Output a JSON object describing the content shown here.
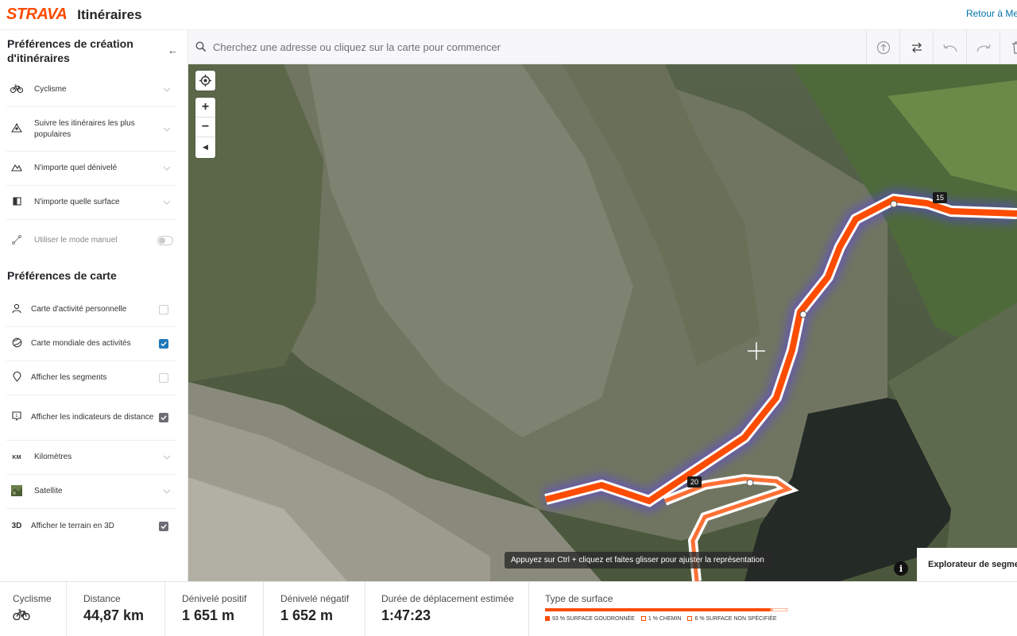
{
  "header": {
    "logo": "STRAVA",
    "title": "Itinéraires",
    "back_link": "Retour à Mes"
  },
  "sidebar": {
    "route_prefs_title": "Préférences de création d'itinéraires",
    "collapse_icon": "arrow-left-icon",
    "route_items": [
      {
        "label": "Cyclisme",
        "icon": "bike-icon"
      },
      {
        "label": "Suivre les itinéraires les plus populaires",
        "icon": "popularity-icon"
      },
      {
        "label": "N'importe quel dénivelé",
        "icon": "elevation-icon"
      },
      {
        "label": "N'importe quelle surface",
        "icon": "surface-icon"
      },
      {
        "label": "Utiliser le mode manuel",
        "icon": "manual-mode-icon",
        "toggle": false
      }
    ],
    "map_prefs_title": "Préférences de carte",
    "map_items": [
      {
        "label": "Carte d'activité personnelle",
        "icon": "person-icon",
        "checked": false
      },
      {
        "label": "Carte mondiale des activités",
        "icon": "globe-icon",
        "checked": true
      },
      {
        "label": "Afficher les segments",
        "icon": "segment-pin-icon",
        "checked": false
      },
      {
        "label": "Afficher les indicateurs de distance",
        "icon": "distance-marker-icon",
        "checked": true
      },
      {
        "label": "Kilomètres",
        "icon": "km-icon",
        "icon_text": "KM"
      },
      {
        "label": "Satellite",
        "icon": "satellite-thumbnail-icon"
      },
      {
        "label": "Afficher le terrain en 3D",
        "icon": "3d-icon",
        "icon_text": "3D",
        "checked": true
      }
    ]
  },
  "search": {
    "placeholder": "Cherchez une adresse ou cliquez sur la carte pour commencer"
  },
  "toolbar": {
    "icons": [
      "elevation-up-icon",
      "reverse-route-icon",
      "undo-icon",
      "redo-icon",
      "trash-icon"
    ]
  },
  "map": {
    "zoom_in": "+",
    "zoom_out": "−",
    "marker_15": "15",
    "marker_20": "20",
    "tooltip": "Appuyez sur Ctrl + cliquez et faites glisser pour ajuster la représentation",
    "info": "i",
    "explorer": "Explorateur de segme"
  },
  "stats": {
    "activity_label": "Cyclisme",
    "activity_icon": "bike-icon",
    "distance_label": "Distance",
    "distance_value": "44,87 km",
    "gain_label": "Dénivelé positif",
    "gain_value": "1 651 m",
    "loss_label": "Dénivelé négatif",
    "loss_value": "1 652 m",
    "duration_label": "Durée de déplacement estimée",
    "duration_value": "1:47:23",
    "surface_label": "Type de surface",
    "surface": [
      {
        "label": "93 % SURFACE GOUDRONNÉE",
        "percent": 93,
        "color": "#fc4c02"
      },
      {
        "label": "1 % CHEMIN",
        "percent": 1,
        "color": "#f7a77f"
      },
      {
        "label": "6 % SURFACE NON SPÉCIFIÉE",
        "percent": 6,
        "color": "#ffffff"
      }
    ]
  },
  "colors": {
    "brand": "#fc4c02",
    "checkbox_blue": "#1c79b8",
    "link": "#0073aa"
  }
}
